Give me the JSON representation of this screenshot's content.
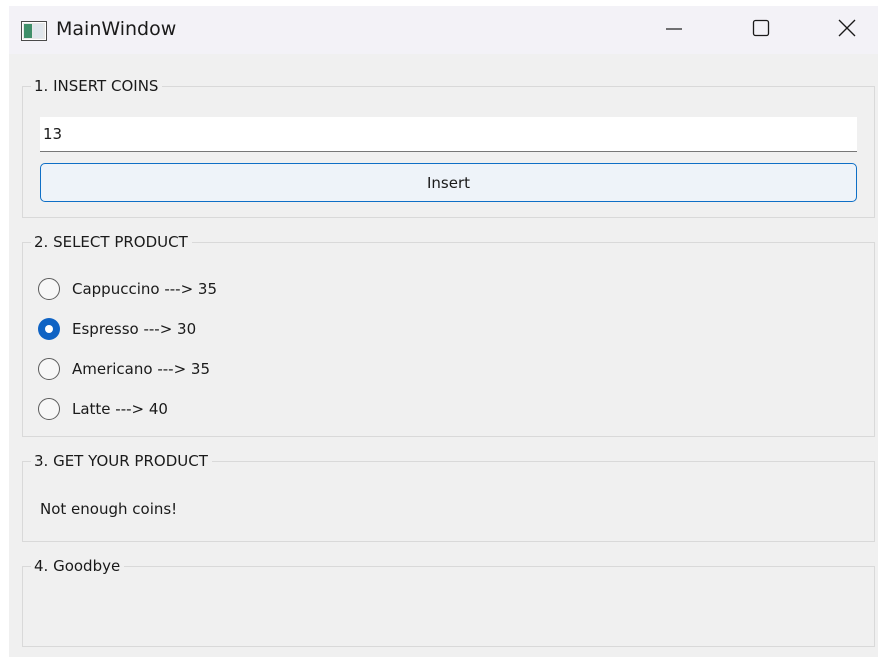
{
  "window": {
    "title": "MainWindow"
  },
  "insert_coins": {
    "group_title": "1. INSERT COINS",
    "input_value": "13",
    "button_label": "Insert"
  },
  "select_product": {
    "group_title": "2. SELECT PRODUCT",
    "options": [
      {
        "label": "Cappuccino ---> 35",
        "checked": false
      },
      {
        "label": "Espresso ---> 30",
        "checked": true
      },
      {
        "label": "Americano ---> 35",
        "checked": false
      },
      {
        "label": "Latte ---> 40",
        "checked": false
      }
    ]
  },
  "get_product": {
    "group_title": "3. GET YOUR PRODUCT",
    "status": "Not enough coins!"
  },
  "goodbye": {
    "group_title": "4. Goodbye"
  },
  "colors": {
    "accent": "#0f63c4",
    "window_bg": "#f0f0f0",
    "titlebar_bg": "#f3f2f7"
  },
  "icons": {
    "app": "app-window-icon",
    "minimize": "minimize-icon",
    "maximize": "maximize-icon",
    "close": "close-icon"
  }
}
